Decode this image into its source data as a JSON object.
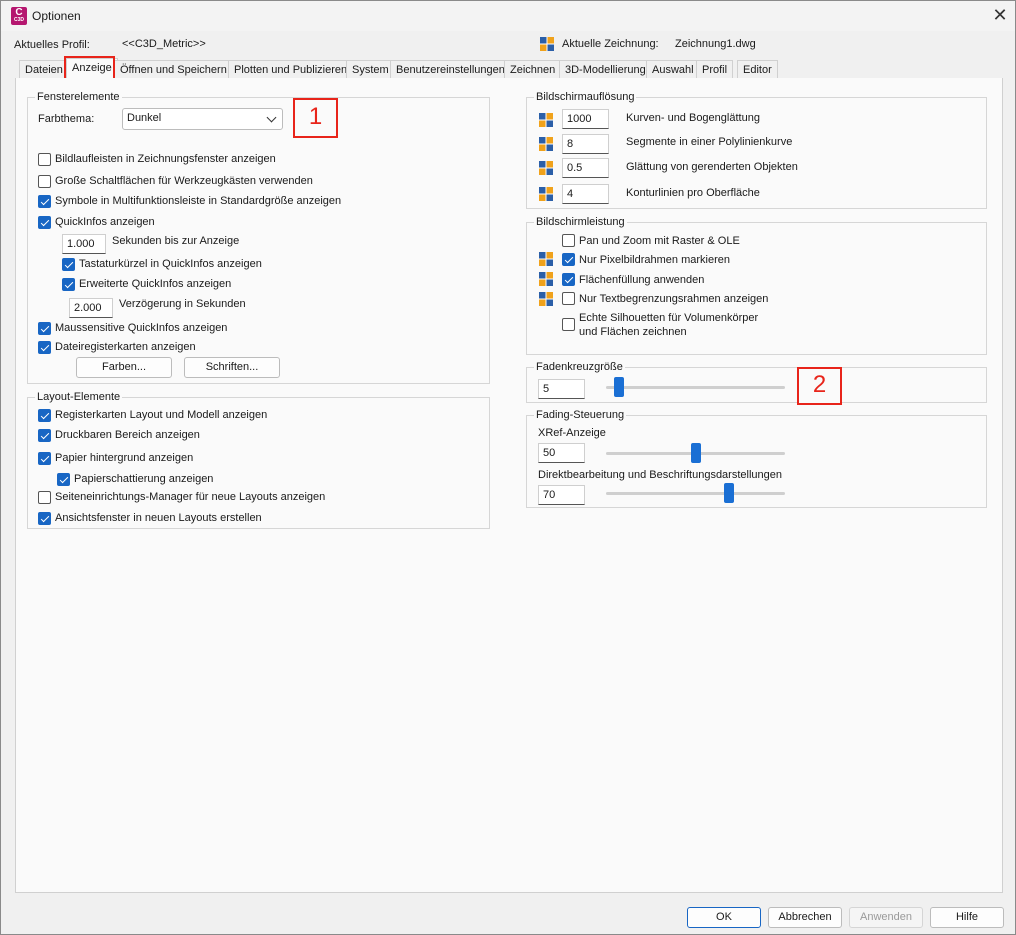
{
  "window": {
    "title": "Optionen",
    "app_icon_letter": "C",
    "app_icon_sub": "C3D",
    "close": "✕"
  },
  "profile": {
    "label": "Aktuelles Profil:",
    "value": "<<C3D_Metric>>"
  },
  "drawing": {
    "label": "Aktuelle Zeichnung:",
    "value": "Zeichnung1.dwg"
  },
  "tabs": [
    "Dateien",
    "Anzeige",
    "Öffnen und Speichern",
    "Plotten und Publizieren",
    "System",
    "Benutzereinstellungen",
    "Zeichnen",
    "3D-Modellierung",
    "Auswahl",
    "Profil",
    "Editor"
  ],
  "active_tab": "Anzeige",
  "fenster": {
    "title": "Fensterelemente",
    "farbthema_label": "Farbthema:",
    "farbthema_value": "Dunkel",
    "cb1": "Bildlaufleisten in Zeichnungsfenster anzeigen",
    "cb2": "Große Schaltflächen für Werkzeugkästen verwenden",
    "cb3": "Symbole in Multifunktionsleiste in Standardgröße anzeigen",
    "cb4": "QuickInfos anzeigen",
    "sek_value": "1.000",
    "sek_label": "Sekunden bis zur Anzeige",
    "cb5": "Tastaturkürzel in QuickInfos anzeigen",
    "cb6": "Erweiterte QuickInfos anzeigen",
    "verz_value": "2.000",
    "verz_label": "Verzögerung in Sekunden",
    "cb7": "Maussensitive QuickInfos anzeigen",
    "cb8": "Dateiregisterkarten anzeigen",
    "farben_button": "Farben...",
    "schriften_button": "Schriften..."
  },
  "layout": {
    "title": "Layout-Elemente",
    "cb1": "Registerkarten Layout und Modell anzeigen",
    "cb2": "Druckbaren Bereich anzeigen",
    "cb3": "Papier hintergrund anzeigen",
    "cb4": "Papierschattierung anzeigen",
    "cb5": "Seiteneinrichtungs-Manager für neue Layouts anzeigen",
    "cb6": "Ansichtsfenster in neuen Layouts erstellen"
  },
  "aufloesung": {
    "title": "Bildschirmauflösung",
    "rows": [
      {
        "value": "1000",
        "label": "Kurven- und Bogenglättung"
      },
      {
        "value": "8",
        "label": "Segmente in einer Polylinienkurve"
      },
      {
        "value": "0.5",
        "label": "Glättung von gerenderten Objekten"
      },
      {
        "value": "4",
        "label": "Konturlinien pro Oberfläche"
      }
    ]
  },
  "leistung": {
    "title": "Bildschirmleistung",
    "cb1": "Pan und Zoom mit Raster & OLE",
    "cb2": "Nur Pixelbildrahmen markieren",
    "cb3": "Flächenfüllung anwenden",
    "cb4": "Nur Textbegrenzungsrahmen anzeigen",
    "cb5a": "Echte Silhouetten für Volumenkörper",
    "cb5b": "und Flächen zeichnen"
  },
  "faden": {
    "title": "Fadenkreuzgröße",
    "value": "5",
    "level": 0.05
  },
  "fading": {
    "title": "Fading-Steuerung",
    "xref_label": "XRef-Anzeige",
    "xref_value": "50",
    "xref_level": 0.5,
    "direkt_label": "Direktbearbeitung und Beschriftungsdarstellungen",
    "direkt_value": "70",
    "direkt_level": 0.7
  },
  "callouts": {
    "one": "1",
    "two": "2"
  },
  "footer": {
    "ok": "OK",
    "cancel": "Abbrechen",
    "apply": "Anwenden",
    "help": "Hilfe"
  },
  "colors": {
    "accent": "#1866c4",
    "callout": "#e8241a",
    "app_icon": "#b5166f"
  }
}
